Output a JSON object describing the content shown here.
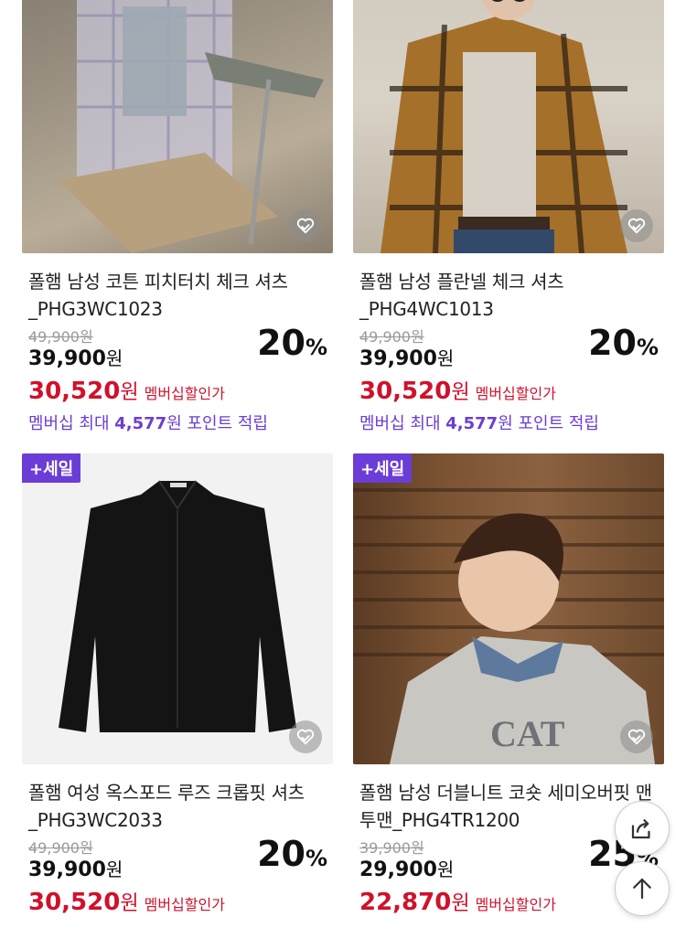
{
  "products": [
    {
      "name": "폴햄 남성 코튼 피치터치 체크 셔츠_PHG3WC1023",
      "original_price": "49,900원",
      "price_num": "39,900",
      "price_unit": "원",
      "discount_num": "20",
      "discount_unit": "%",
      "member_price_num": "30,520",
      "member_price_unit": "원",
      "member_label": "멤버십할인가",
      "points_prefix": "멤버십 최대 ",
      "points_value": "4,577",
      "points_suffix": "원 포인트 적립",
      "sale_tag": ""
    },
    {
      "name": "폴햄 남성 플란넬 체크 셔츠_PHG4WC1013",
      "original_price": "49,900원",
      "price_num": "39,900",
      "price_unit": "원",
      "discount_num": "20",
      "discount_unit": "%",
      "member_price_num": "30,520",
      "member_price_unit": "원",
      "member_label": "멤버십할인가",
      "points_prefix": "멤버십 최대 ",
      "points_value": "4,577",
      "points_suffix": "원 포인트 적립",
      "sale_tag": ""
    },
    {
      "name": "폴햄 여성 옥스포드 루즈 크롭핏 셔츠_PHG3WC2033",
      "original_price": "49,900원",
      "price_num": "39,900",
      "price_unit": "원",
      "discount_num": "20",
      "discount_unit": "%",
      "member_price_num": "30,520",
      "member_price_unit": "원",
      "member_label": "멤버십할인가",
      "sale_tag": "+세일"
    },
    {
      "name": "폴햄 남성 더블니트 코숏 세미오버핏 맨투맨_PHG4TR1200",
      "original_price": "39,900원",
      "price_num": "29,900",
      "price_unit": "원",
      "discount_num": "25",
      "discount_unit": "%",
      "member_price_num": "22,870",
      "member_price_unit": "원",
      "member_label": "멤버십할인가",
      "sale_tag": "+세일"
    }
  ],
  "icons": {
    "wishlist": "heart-hands-icon",
    "share": "share-icon",
    "top": "arrow-up-icon"
  },
  "colors": {
    "accent": "#6b3dd6",
    "member_red": "#d0112b"
  }
}
